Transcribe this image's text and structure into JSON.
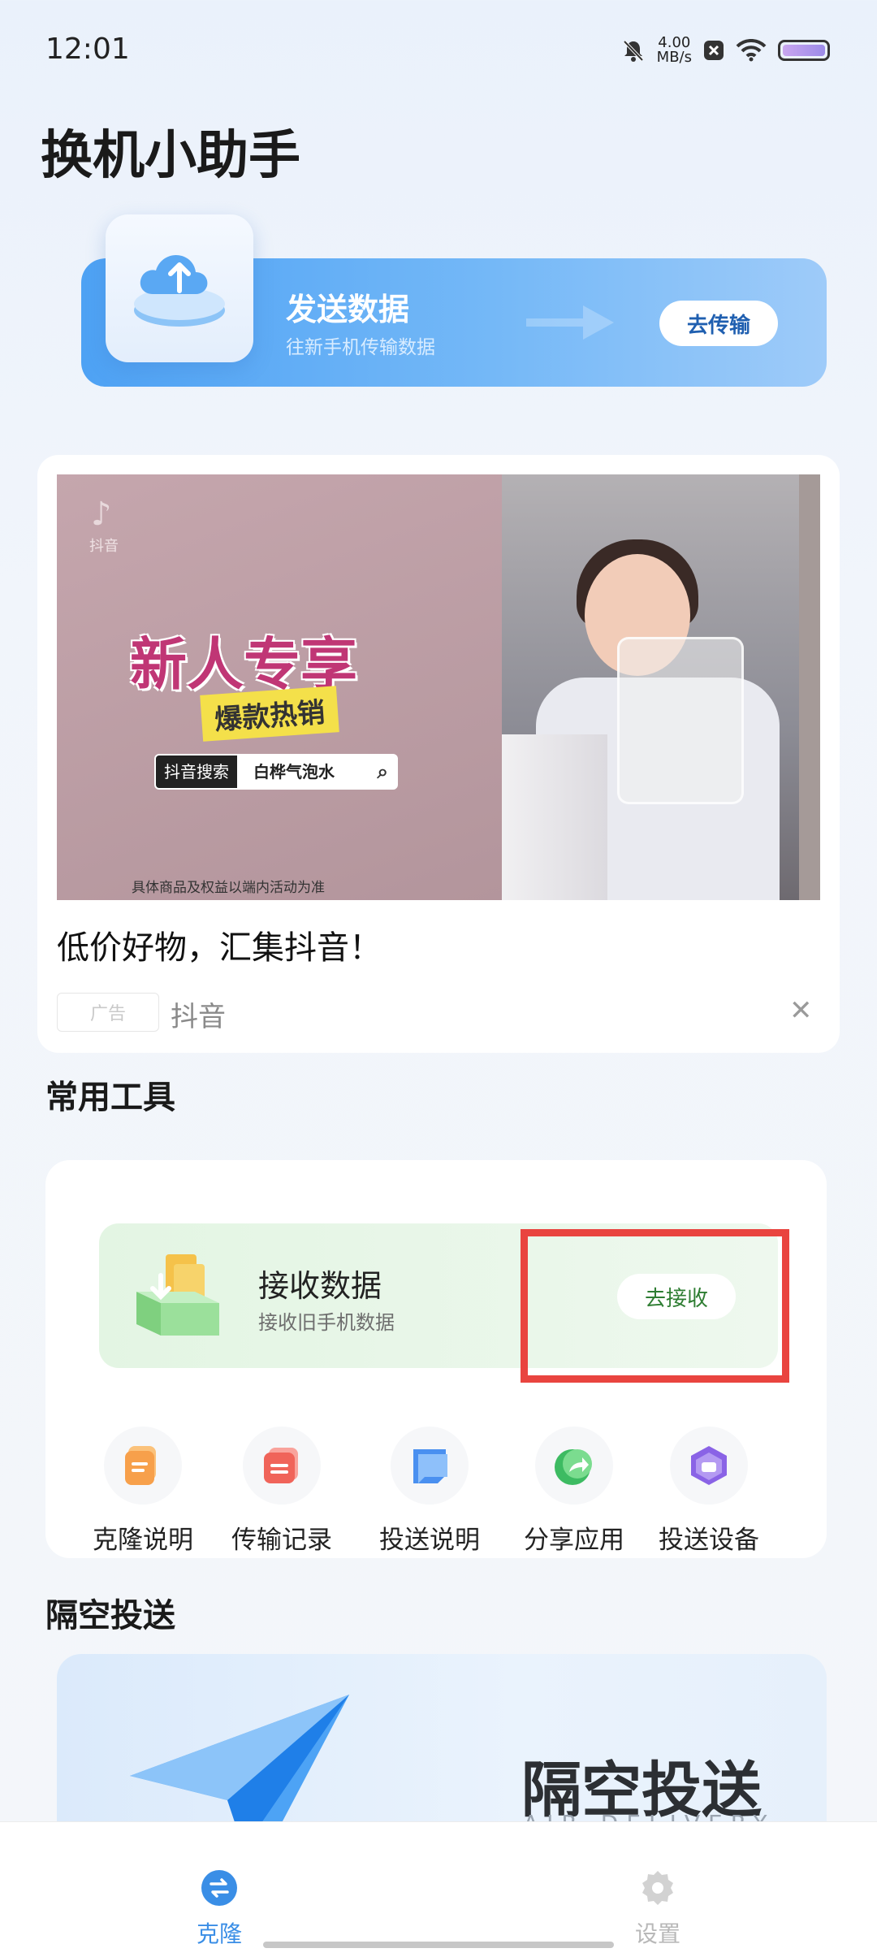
{
  "status_bar": {
    "time": "12:01",
    "speed_value": "4.00",
    "speed_unit": "MB/s"
  },
  "app_title": "换机小助手",
  "send_card": {
    "title": "发送数据",
    "subtitle": "往新手机传输数据",
    "button": "去传输"
  },
  "ad": {
    "app_logo_name": "抖音",
    "headline": "新人专享",
    "subheadline": "爆款热销",
    "search_tag": "抖音搜索",
    "search_value": "白桦气泡水",
    "disclaimer": "具体商品及权益以端内活动为准",
    "caption": "低价好物，汇集抖音！",
    "badge": "广告",
    "source": "抖音"
  },
  "tools_section": {
    "title": "常用工具",
    "receive": {
      "title": "接收数据",
      "subtitle": "接收旧手机数据",
      "button": "去接收"
    },
    "items": [
      {
        "label": "克隆说明",
        "icon": "clone-doc-icon",
        "color": "#f7a04b"
      },
      {
        "label": "传输记录",
        "icon": "transfer-record-icon",
        "color": "#f0645a"
      },
      {
        "label": "投送说明",
        "icon": "delivery-doc-icon",
        "color": "#4a90f0"
      },
      {
        "label": "分享应用",
        "icon": "share-app-icon",
        "color": "#3dbb62"
      },
      {
        "label": "投送设备",
        "icon": "delivery-device-icon",
        "color": "#8a63e6"
      }
    ]
  },
  "air_section": {
    "title": "隔空投送",
    "banner_title": "隔空投送",
    "banner_subtitle": "AIR DELIVERY"
  },
  "tabbar": {
    "items": [
      {
        "label": "克隆",
        "active": true
      },
      {
        "label": "设置",
        "active": false
      }
    ]
  },
  "colors": {
    "accent": "#3a8ee6",
    "receive_green": "#2e7d32",
    "highlight": "#e9443f"
  }
}
